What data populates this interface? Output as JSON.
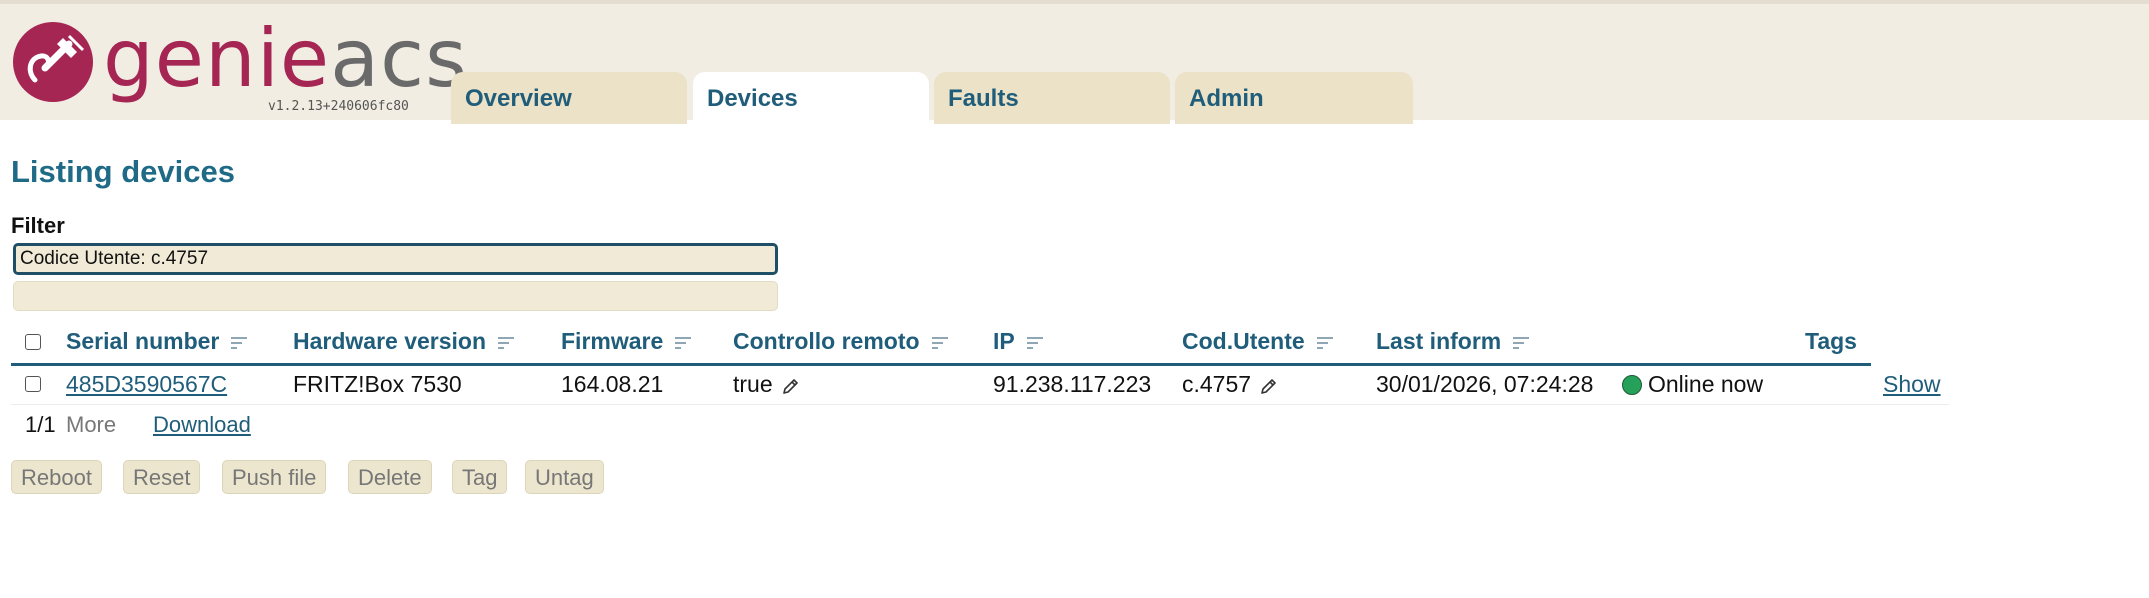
{
  "logo": {
    "genie": "genie",
    "acs": "acs",
    "version": "v1.2.13+240606fc80"
  },
  "tabs": [
    {
      "label": "Overview",
      "active": false
    },
    {
      "label": "Devices",
      "active": true
    },
    {
      "label": "Faults",
      "active": false
    },
    {
      "label": "Admin",
      "active": false
    }
  ],
  "page": {
    "title": "Listing devices"
  },
  "filter": {
    "label": "Filter",
    "value": "Codice Utente: c.4757",
    "extra_value": ""
  },
  "table": {
    "columns": [
      "Serial number",
      "Hardware version",
      "Firmware",
      "Controllo remoto",
      "IP",
      "Cod.Utente",
      "Last inform",
      "Tags"
    ],
    "rows": [
      {
        "serial": "485D3590567C",
        "hardware": "FRITZ!Box 7530",
        "firmware": "164.08.21",
        "remote": "true",
        "ip": "91.238.117.223",
        "user_code": "c.4757",
        "last_inform": "30/01/2026, 07:24:28",
        "status": "Online now",
        "show": "Show"
      }
    ]
  },
  "pager": {
    "count": "1/1",
    "more": "More",
    "download": "Download"
  },
  "actions": [
    "Reboot",
    "Reset",
    "Push file",
    "Delete",
    "Tag",
    "Untag"
  ],
  "colors": {
    "accent": "#1f5d7a",
    "brand": "#a52553",
    "topbar": "#f1ede3",
    "tab": "#ebe2c7",
    "online": "#27a05a"
  }
}
